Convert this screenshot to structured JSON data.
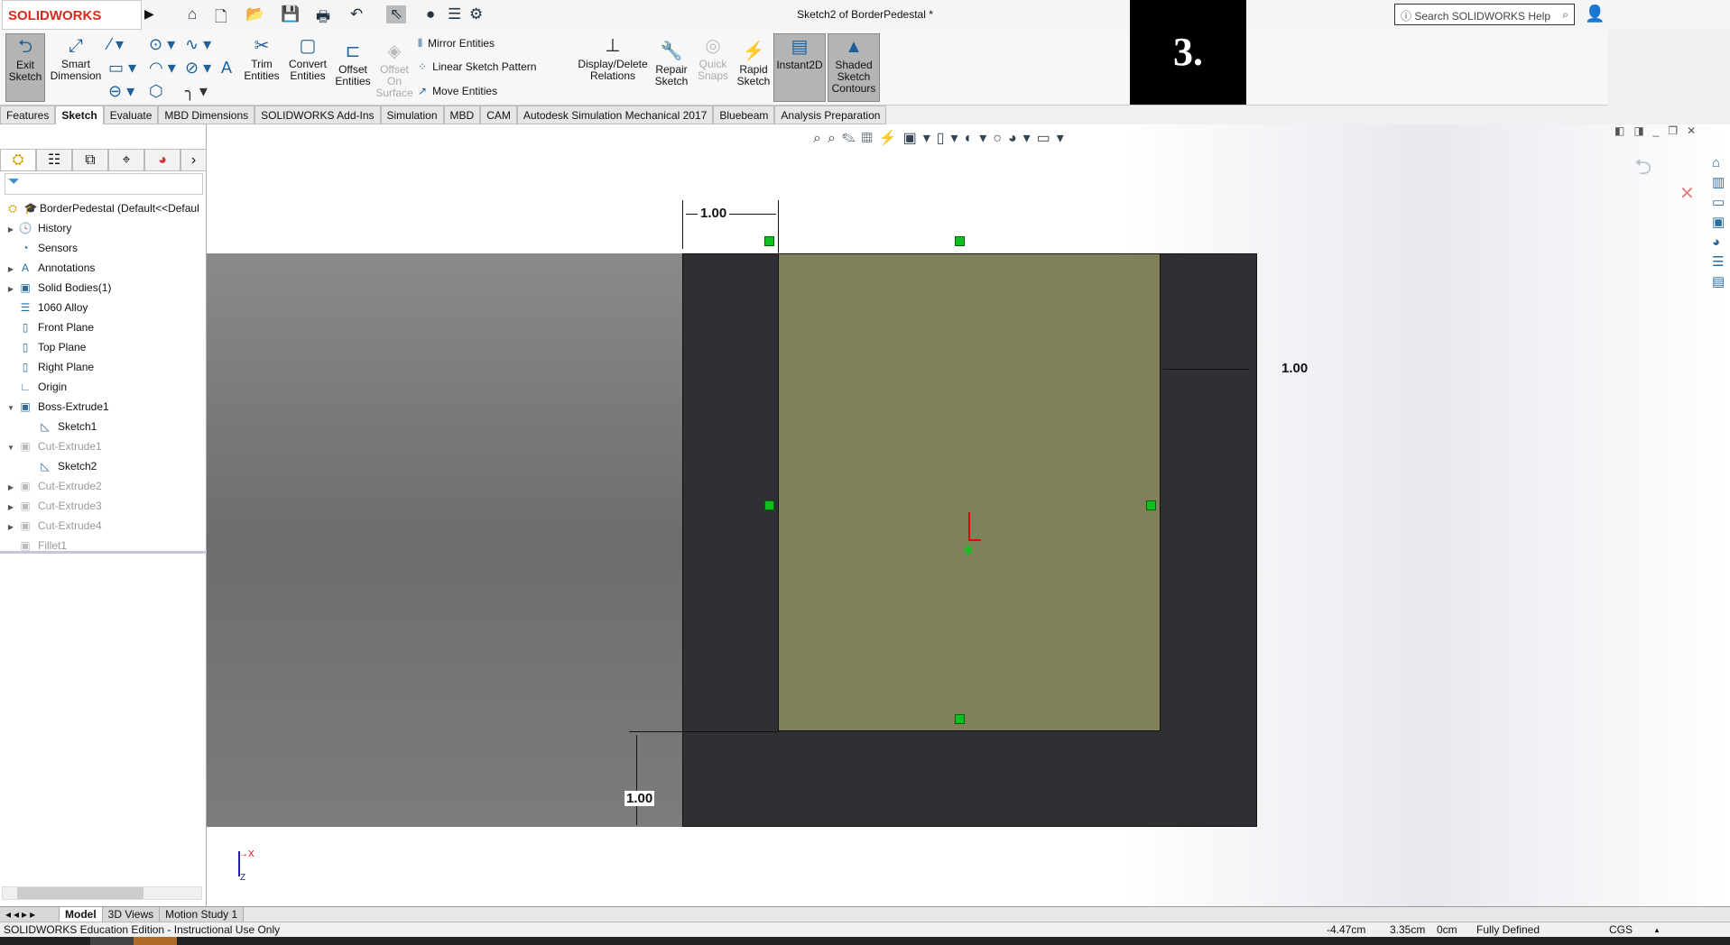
{
  "app": {
    "logo": "SOLIDWORKS",
    "title": "Sketch2 of BorderPedestal *",
    "search_placeholder": "Search SOLIDWORKS Help",
    "overlay_label": "3."
  },
  "quick_access": [
    "home-icon",
    "new-icon",
    "open-icon",
    "save-icon",
    "print-icon",
    "undo-icon",
    "select-icon",
    "traffic-light-icon",
    "file-properties-icon",
    "options-icon"
  ],
  "ribbon": {
    "exit_sketch": "Exit Sketch",
    "smart_dimension": "Smart Dimension",
    "trim_entities": "Trim Entities",
    "convert_entities": "Convert Entities",
    "offset_entities": "Offset Entities",
    "offset_on_surface": "Offset On Surface",
    "mirror_entities": "Mirror Entities",
    "linear_sketch_pattern": "Linear Sketch Pattern",
    "move_entities": "Move Entities",
    "display_delete_relations": "Display/Delete Relations",
    "repair_sketch": "Repair Sketch",
    "quick_snaps": "Quick Snaps",
    "rapid_sketch": "Rapid Sketch",
    "instant2d": "Instant2D",
    "shaded_sketch_contours": "Shaded Sketch Contours"
  },
  "tabs": [
    "Features",
    "Sketch",
    "Evaluate",
    "MBD Dimensions",
    "SOLIDWORKS Add-Ins",
    "Simulation",
    "MBD",
    "CAM",
    "Autodesk Simulation Mechanical 2017",
    "Bluebeam",
    "Analysis Preparation"
  ],
  "active_tab": "Sketch",
  "tree": {
    "root": "BorderPedestal  (Default<<Defaul",
    "items": [
      {
        "label": "History",
        "expand": "▶",
        "dim": false,
        "indent": 0
      },
      {
        "label": "Sensors",
        "expand": "",
        "dim": false,
        "indent": 0
      },
      {
        "label": "Annotations",
        "expand": "▶",
        "dim": false,
        "indent": 0
      },
      {
        "label": "Solid Bodies(1)",
        "expand": "▶",
        "dim": false,
        "indent": 0
      },
      {
        "label": "1060 Alloy",
        "expand": "",
        "dim": false,
        "indent": 0
      },
      {
        "label": "Front Plane",
        "expand": "",
        "dim": false,
        "indent": 0
      },
      {
        "label": "Top Plane",
        "expand": "",
        "dim": false,
        "indent": 0
      },
      {
        "label": "Right Plane",
        "expand": "",
        "dim": false,
        "indent": 0
      },
      {
        "label": "Origin",
        "expand": "",
        "dim": false,
        "indent": 0
      },
      {
        "label": "Boss-Extrude1",
        "expand": "▼",
        "dim": false,
        "indent": 0
      },
      {
        "label": "Sketch1",
        "expand": "",
        "dim": false,
        "indent": 1
      },
      {
        "label": "Cut-Extrude1",
        "expand": "▼",
        "dim": true,
        "indent": 0
      },
      {
        "label": "Sketch2",
        "expand": "",
        "dim": false,
        "indent": 1
      },
      {
        "label": "Cut-Extrude2",
        "expand": "▶",
        "dim": true,
        "indent": 0
      },
      {
        "label": "Cut-Extrude3",
        "expand": "▶",
        "dim": true,
        "indent": 0
      },
      {
        "label": "Cut-Extrude4",
        "expand": "▶",
        "dim": true,
        "indent": 0
      },
      {
        "label": "Fillet1",
        "expand": "",
        "dim": true,
        "indent": 0
      }
    ]
  },
  "sketch": {
    "dim_top": "1.00",
    "dim_right": "1.00",
    "dim_bottom": "1.00"
  },
  "bottom_tabs": [
    "Model",
    "3D Views",
    "Motion Study 1"
  ],
  "status": {
    "edition": "SOLIDWORKS Education Edition - Instructional Use Only",
    "x": "-4.47cm",
    "y": "3.35cm",
    "z": "0cm",
    "state": "Fully Defined",
    "units": "CGS"
  },
  "colors": {
    "sketch_face": "#80805a",
    "part_body": "#2e3033",
    "relation": "#10c020",
    "brand": "#d52b1e"
  }
}
